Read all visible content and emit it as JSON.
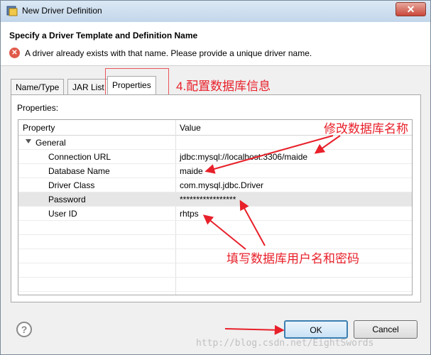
{
  "window": {
    "title": "New Driver Definition",
    "close_glyph": "✕"
  },
  "header": {
    "title": "Specify a Driver Template and Definition Name",
    "error_icon_glyph": "✕",
    "error_message": "A driver already exists with that name. Please provide a unique driver name."
  },
  "tabs": [
    {
      "label": "Name/Type",
      "active": false
    },
    {
      "label": "JAR List",
      "active": false
    },
    {
      "label": "Properties",
      "active": true
    }
  ],
  "properties": {
    "section_label": "Properties:",
    "columns": [
      "Property",
      "Value"
    ],
    "group": "General",
    "rows": [
      {
        "property": "Connection URL",
        "value": "jdbc:mysql://localhost:3306/maide"
      },
      {
        "property": "Database Name",
        "value": "maide"
      },
      {
        "property": "Driver Class",
        "value": "com.mysql.jdbc.Driver"
      },
      {
        "property": "Password",
        "value": "*****************"
      },
      {
        "property": "User ID",
        "value": "rhtps"
      }
    ]
  },
  "annotations": {
    "step4": "4.配置数据库信息",
    "modify_db_name": "修改数据库名称",
    "fill_user_password": "填写数据库用户名和密码"
  },
  "footer": {
    "help_glyph": "?",
    "ok_label": "OK",
    "cancel_label": "Cancel",
    "watermark": "http://blog.csdn.net/EightSwords"
  },
  "colors": {
    "annotation": "#e8202a",
    "ok_border": "#3c7fb1"
  }
}
